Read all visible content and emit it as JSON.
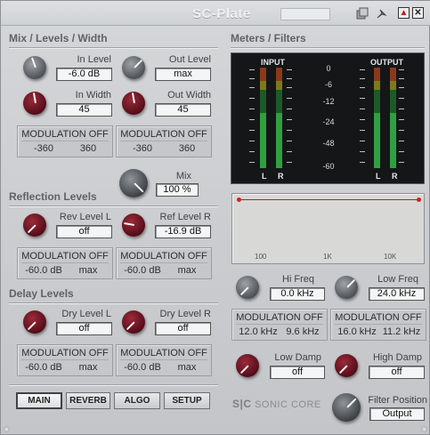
{
  "window": {
    "title": "SC-Plate",
    "minimize_glyph": "▲",
    "close_glyph": "✕"
  },
  "icons": {
    "copy": "copy-icon",
    "pin": "pin-icon"
  },
  "sections": {
    "mix": "Mix / Levels / Width",
    "reflection": "Reflection Levels",
    "delay": "Delay Levels",
    "meters": "Meters / Filters"
  },
  "controls": {
    "in_level": {
      "label": "In Level",
      "value": "-6.0 dB"
    },
    "out_level": {
      "label": "Out Level",
      "value": "max"
    },
    "in_width": {
      "label": "In Width",
      "value": "45"
    },
    "out_width": {
      "label": "Out Width",
      "value": "45"
    },
    "mix": {
      "label": "Mix",
      "value": "100 %"
    },
    "rev_level_l": {
      "label": "Rev Level L",
      "value": "off"
    },
    "ref_level_r": {
      "label": "Ref Level R",
      "value": "-16.9 dB"
    },
    "dry_level_l": {
      "label": "Dry Level L",
      "value": "off"
    },
    "dry_level_r": {
      "label": "Dry Level R",
      "value": "off"
    },
    "hi_freq": {
      "label": "Hi Freq",
      "value": "0.0 kHz"
    },
    "low_freq": {
      "label": "Low Freq",
      "value": "24.0 kHz"
    },
    "low_damp": {
      "label": "Low Damp",
      "value": "off"
    },
    "high_damp": {
      "label": "High Damp",
      "value": "off"
    },
    "filter_position": {
      "label": "Filter Position",
      "value": "Output"
    }
  },
  "modulation": {
    "in_level": {
      "title": "MODULATION OFF",
      "min": "-360",
      "max": "360"
    },
    "out_level": {
      "title": "MODULATION OFF",
      "min": "-360",
      "max": "360"
    },
    "rev_l": {
      "title": "MODULATION OFF",
      "min": "-60.0 dB",
      "max": "max"
    },
    "ref_r": {
      "title": "MODULATION OFF",
      "min": "-60.0 dB",
      "max": "max"
    },
    "dry_l": {
      "title": "MODULATION OFF",
      "min": "-60.0 dB",
      "max": "max"
    },
    "dry_r": {
      "title": "MODULATION OFF",
      "min": "-60.0 dB",
      "max": "max"
    },
    "hi_freq": {
      "title": "MODULATION OFF",
      "min": "12.0 kHz",
      "max": "9.6 kHz"
    },
    "low_freq": {
      "title": "MODULATION OFF",
      "min": "16.0 kHz",
      "max": "11.2 kHz"
    }
  },
  "meters": {
    "input_label": "INPUT",
    "output_label": "OUTPUT",
    "scale": [
      "0",
      "-6",
      "-12",
      "-24",
      "-48",
      "-60"
    ],
    "channels": [
      "L",
      "R"
    ],
    "input_levels": [
      0.55,
      0.55
    ],
    "output_levels": [
      0.55,
      0.55
    ]
  },
  "filter_graph": {
    "labels": [
      "100",
      "1K",
      "10K"
    ]
  },
  "tabs": [
    "MAIN",
    "REVERB",
    "ALGO",
    "SETUP"
  ],
  "active_tab": "MAIN",
  "brand": {
    "mark": "S|C",
    "name": "SONIC CORE"
  },
  "colors": {
    "meter_green": "#2fa040",
    "knob_red": "#5a0f1b",
    "filter_dot": "#d5201d"
  }
}
